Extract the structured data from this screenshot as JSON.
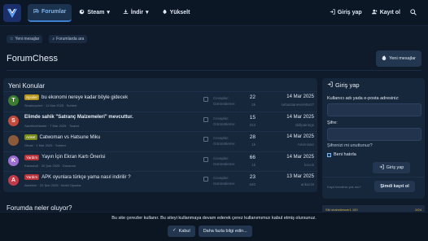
{
  "nav": {
    "items": [
      {
        "label": "Forumlar",
        "icon": "chat-bubbles-icon",
        "active": true
      },
      {
        "label": "Steam",
        "icon": "steam-icon",
        "dropdown": true
      },
      {
        "label": "İndir",
        "icon": "download-icon",
        "dropdown": true
      },
      {
        "label": "Yükselt",
        "icon": "rocket-icon"
      }
    ],
    "login_label": "Giriş yap",
    "register_label": "Kayıt ol"
  },
  "subbar": {
    "new_messages": "Yeni mesajlar",
    "search_forums": "Forumlarda ara"
  },
  "page": {
    "title": "ForumChess",
    "new_messages_button": "Yeni mesajlar"
  },
  "latest": {
    "title": "Yeni Konular",
    "stat_labels": [
      "Cevaplar:",
      "Görüntüleme:"
    ],
    "threads": [
      {
        "avatar_letter": "T",
        "avatar_color": "#3a7d2e",
        "tag": "Spoiler",
        "tag_color": "#b7951a",
        "title": "bu ekonomi nereye kadar böyle gidecek",
        "bold": false,
        "author": "Sinalucycle4",
        "date": "11 Mar 2025",
        "forum": "Sohbet",
        "replies": "22",
        "views": "2k",
        "last_date": "14 Mar 2025",
        "last_user": "sebastianeverette27"
      },
      {
        "avatar_letter": "S",
        "avatar_color": "#c24b3c",
        "tag": "",
        "tag_color": "",
        "title": "Elimde sahik \"Satranç Malzemeleri\" mevcuttur.",
        "bold": true,
        "author": "SacrificeMaster",
        "date": "7 Mar 2025",
        "forum": "Ticaret",
        "replies": "15",
        "views": "313",
        "last_date": "14 Mar 2025",
        "last_user": "skillpairings"
      },
      {
        "avatar_letter": "",
        "avatar_color": "#8a5a3a",
        "tag": "Anket",
        "tag_color": "#7a8a1a",
        "title": "Catwoman vs Hatsune Miku",
        "bold": false,
        "author": "Ghost",
        "date": "1 Mar 2025",
        "forum": "Sohbet",
        "replies": "28",
        "views": "1k",
        "last_date": "14 Mar 2025",
        "last_user": "Artemisan"
      },
      {
        "avatar_letter": "K",
        "avatar_color": "#9b6fcf",
        "tag": "Yardım",
        "tag_color": "#b8323a",
        "title": "Yayın İçin Ekran Kartı Önerisi",
        "bold": false,
        "author": "Karaseu0",
        "date": "20 Şub 2025",
        "forum": "Donanım",
        "replies": "66",
        "views": "1k",
        "last_date": "14 Mar 2025",
        "last_user": "knock"
      },
      {
        "avatar_letter": "A",
        "avatar_color": "#c23a4a",
        "tag": "Yardım",
        "tag_color": "#b8323a",
        "title": "APK oyunlara türkçe yama nasıl indirilir ?",
        "bold": false,
        "author": "Akeelinn",
        "date": "22 Şub 2025",
        "forum": "Mobil Oyunlar",
        "replies": "23",
        "views": "540",
        "last_date": "13 Mar 2025",
        "last_user": "ankar18"
      }
    ]
  },
  "login_box": {
    "title": "Giriş yap",
    "username_label": "Kullanıcı adı yada e-posta adresiniz:",
    "password_label": "Şifre:",
    "forgot_label": "Şifrenizi mi unuttunuz?",
    "remember_label": "Beni hatırla",
    "login_button": "Giriş yap",
    "register_prompt": "Kayıt trendiniz yok mu?",
    "register_button": "Şimdi kayıt ol"
  },
  "bottom": {
    "whats_new": "Forumda neler oluyor?",
    "stream_left": "SM shahsilencer1 100",
    "stream_right": "0/24"
  },
  "cookie": {
    "text": "Bu site çerezler kullanır. Bu siteyi kullanmaya devam ederek çerez kullanımımızı kabul etmiş olursunuz.",
    "accept": "Kabul",
    "more": "Daha fazla bilgi edin..."
  }
}
